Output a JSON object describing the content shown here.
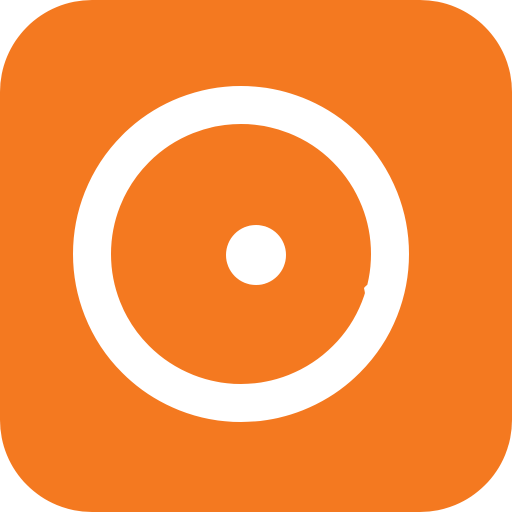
{
  "icon": {
    "name": "orange-ring-app-icon",
    "colors": {
      "background": "#F47920",
      "foreground": "#FFFFFF",
      "page": "#FFFFFF"
    },
    "glyphs": [
      "outer-ring-icon",
      "center-dot-icon"
    ]
  }
}
